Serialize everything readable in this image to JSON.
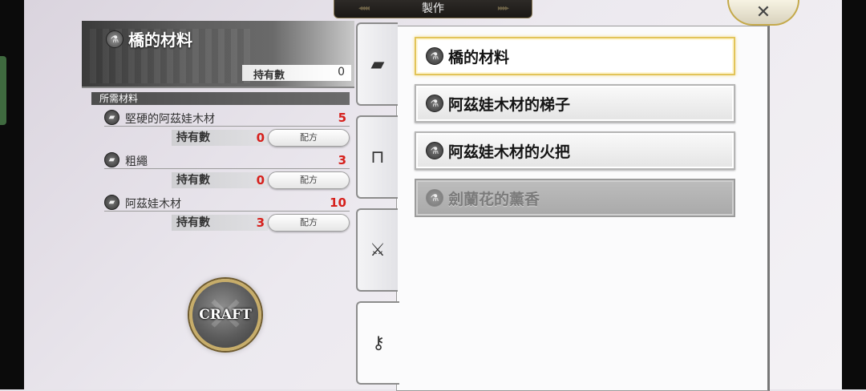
{
  "window": {
    "title": "製作"
  },
  "close": {
    "icon": "close-icon",
    "glyph": "✕"
  },
  "header": {
    "item_name": "橋的材料",
    "item_icon": "bridge-material-icon",
    "owned_label": "持有數",
    "owned_value": "0"
  },
  "materials": {
    "section_label": "所需材料",
    "rows": [
      {
        "name": "堅硬的阿茲娃木材",
        "need": "5",
        "owned_label": "持有數",
        "owned_value": "0",
        "recipe_label": "配方"
      },
      {
        "name": "粗繩",
        "need": "3",
        "owned_label": "持有數",
        "owned_value": "0",
        "recipe_label": "配方"
      },
      {
        "name": "阿茲娃木材",
        "need": "10",
        "owned_label": "持有數",
        "owned_value": "3",
        "recipe_label": "配方"
      }
    ]
  },
  "craft": {
    "label": "CRAFT"
  },
  "categories": [
    {
      "id": "materials",
      "icon": "lumber-icon",
      "glyph": "▰"
    },
    {
      "id": "furniture",
      "icon": "chair-icon",
      "glyph": "⊓"
    },
    {
      "id": "equipment",
      "icon": "sword-shield-icon",
      "glyph": "⚔"
    },
    {
      "id": "key-items",
      "icon": "key-icon",
      "glyph": "⚷"
    }
  ],
  "recipes": [
    {
      "label": "橋的材料",
      "state": "selected"
    },
    {
      "label": "阿茲娃木材的梯子",
      "state": "normal"
    },
    {
      "label": "阿茲娃木材的火把",
      "state": "normal"
    },
    {
      "label": "劍蘭花的薰香",
      "state": "disabled"
    }
  ],
  "colors": {
    "need_red": "#d6201c",
    "selected_border": "#e2c45a",
    "frame_gold": "#c4a94a"
  }
}
